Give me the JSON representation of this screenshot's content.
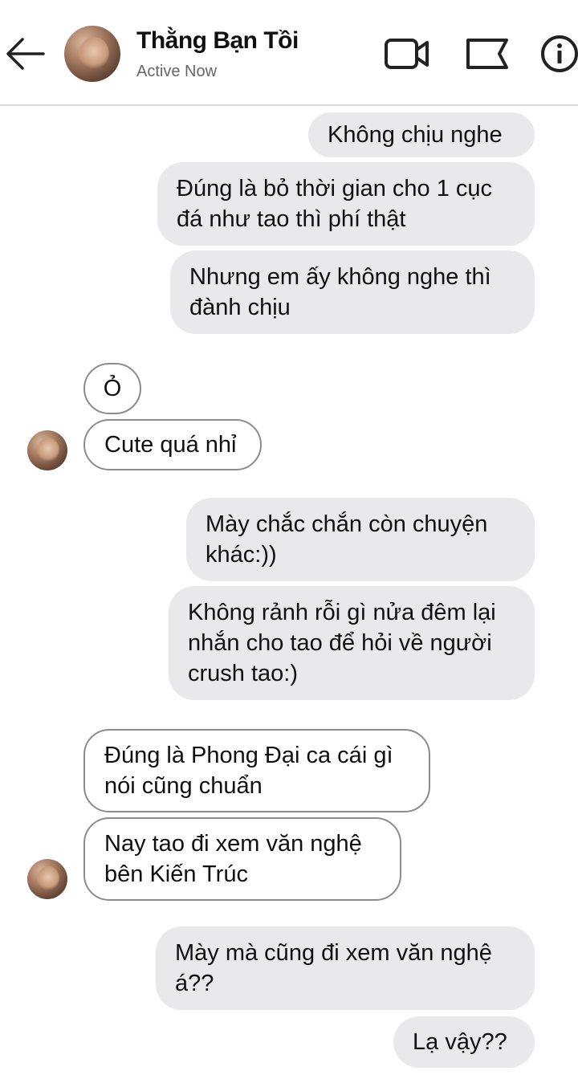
{
  "header": {
    "contact_name": "Thằng Bạn Tồi",
    "status": "Active Now",
    "icons": [
      "back-arrow-icon",
      "video-call-icon",
      "flag-icon",
      "info-icon"
    ]
  },
  "messages": [
    {
      "side": "out",
      "text": "Không chịu nghe"
    },
    {
      "side": "out",
      "text": "Đúng là bỏ thời gian cho 1 cục\nđá như tao thì phí thật"
    },
    {
      "side": "out",
      "text": "Nhưng em ấy không nghe thì\nđành chịu"
    },
    {
      "side": "in",
      "text": "Ỏ"
    },
    {
      "side": "in",
      "text": "Cute quá nhỉ"
    },
    {
      "side": "out",
      "text": "Mày chắc chắn còn chuyện\nkhác:))"
    },
    {
      "side": "out",
      "text": "Không rảnh rỗi gì nửa đêm lại\nnhắn cho tao để hỏi về người\ncrush tao:)"
    },
    {
      "side": "in",
      "text": "Đúng là Phong Đại ca cái gì\nnói cũng chuẩn"
    },
    {
      "side": "in",
      "text": "Nay tao đi xem văn nghệ\nbên Kiến Trúc"
    },
    {
      "side": "out",
      "text": "Mày mà cũng đi xem văn nghệ\ná??"
    },
    {
      "side": "out",
      "text": "Lạ vậy??"
    }
  ],
  "colors": {
    "outgoing_bubble": "#e9e9eb",
    "incoming_border": "#8c8c8c",
    "subtitle": "#666666"
  }
}
